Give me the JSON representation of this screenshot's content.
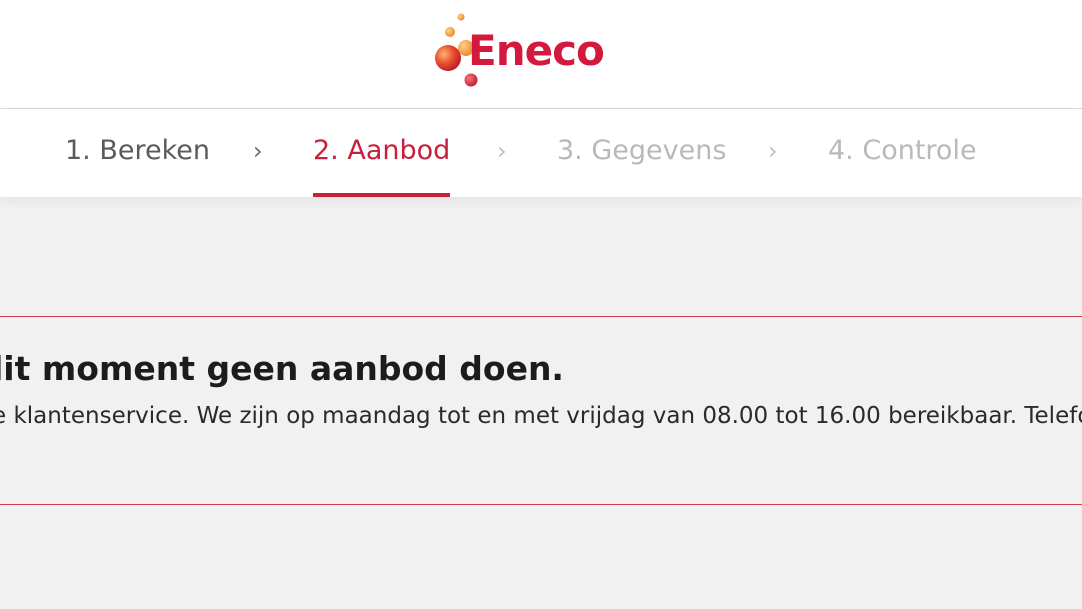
{
  "brand": {
    "name": "Eneco",
    "color": "#d4193e"
  },
  "steps": [
    {
      "label": "1. Bereken",
      "state": "completed"
    },
    {
      "label": "2. Aanbod",
      "state": "active"
    },
    {
      "label": "3. Gegevens",
      "state": "upcoming"
    },
    {
      "label": "4. Controle",
      "state": "upcoming"
    }
  ],
  "step_separator": "›",
  "message": {
    "title": "lit moment geen aanbod doen.",
    "body": "e klantenservice. We zijn op maandag tot en met vrijdag van 08.00 tot 16.00 bereikbaar. Telefo",
    "border_color": "#d23a4f"
  },
  "colors": {
    "accent": "#c8203c",
    "page_background": "#f1f1f2",
    "step_inactive": "#b9b9b9",
    "step_completed": "#5b5b5b"
  },
  "icons": {
    "logo_mark": "eneco-bubbles-icon",
    "separator": "chevron-right-icon"
  }
}
